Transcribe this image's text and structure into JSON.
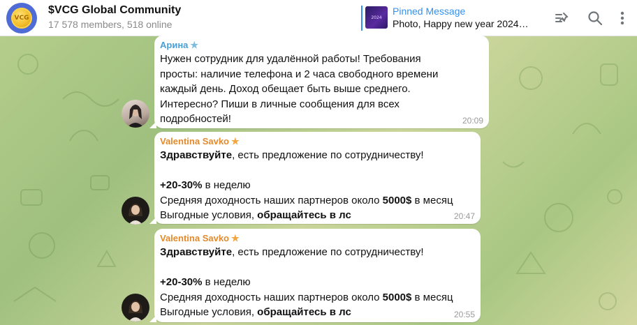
{
  "header": {
    "title": "$VCG Global Community",
    "subtitle": "17 578 members, 518 online",
    "avatar_label": "VCG",
    "pinned": {
      "label": "Pinned Message",
      "text": "Photo, Happy new year 2024!…",
      "thumb_label": "2024"
    },
    "icons": [
      "pinned-list-icon",
      "search-icon",
      "more-icon"
    ]
  },
  "messages": [
    {
      "author": "Арина",
      "author_color": "#4a9ed6",
      "lines": [
        "Нужен сотрудник для удалённой работы! Требования",
        "просты: наличие телефона и 2 часа свободного времени",
        "каждый день. Доход обещает быть выше среднего.",
        "Интересно? Пиши в личные сообщения для всех",
        "подробностей!"
      ],
      "time": "20:09"
    },
    {
      "author": "Valentina Savko",
      "author_color": "#e38a2c",
      "l1_bold": "Здравствуйте",
      "l1_rest": ", есть предложение по сотрудничеству!",
      "l2_bold": "+20-30%",
      "l2_rest": " в неделю",
      "l3_pre": "Средняя доходность наших партнеров около ",
      "l3_bold": "5000$",
      "l3_post": " в месяц",
      "l4_pre": "Выгодные условия, ",
      "l4_bold": "обращайтесь в лс",
      "time": "20:47"
    },
    {
      "author": "Valentina Savko",
      "author_color": "#e38a2c",
      "l1_bold": "Здравствуйте",
      "l1_rest": ", есть предложение по сотрудничеству!",
      "l2_bold": "+20-30%",
      "l2_rest": " в неделю",
      "l3_pre": "Средняя доходность наших партнеров около ",
      "l3_bold": "5000$",
      "l3_post": " в месяц",
      "l4_pre": "Выгодные условия, ",
      "l4_bold": "обращайтесь в лс",
      "time": "20:55"
    }
  ],
  "colors": {
    "accent": "#3390ec",
    "star": "#f2a541"
  }
}
